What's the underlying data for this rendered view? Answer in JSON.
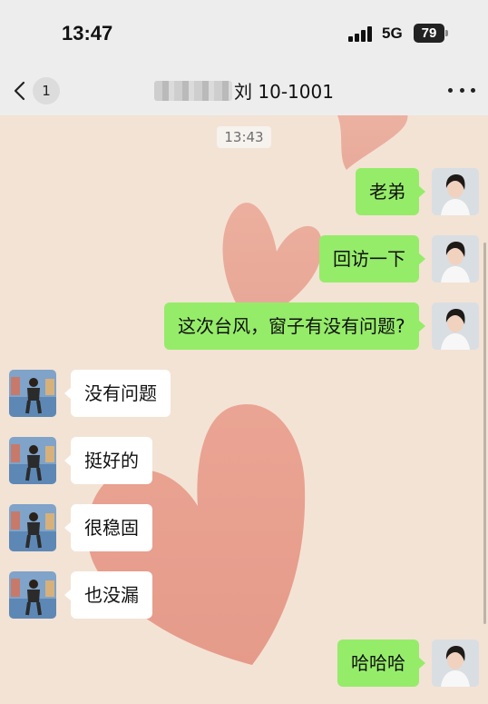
{
  "status_bar": {
    "time": "13:47",
    "network": "5G",
    "battery": "79"
  },
  "nav": {
    "back_count": "1",
    "title": "刘 10-1001"
  },
  "chat": {
    "timestamp": "13:43",
    "messages": [
      {
        "side": "out",
        "text": "老弟"
      },
      {
        "side": "out",
        "text": "回访一下"
      },
      {
        "side": "out",
        "text": "这次台风，窗子有没有问题?"
      },
      {
        "side": "in",
        "text": "没有问题"
      },
      {
        "side": "in",
        "text": "挺好的"
      },
      {
        "side": "in",
        "text": "很稳固"
      },
      {
        "side": "in",
        "text": "也没漏"
      },
      {
        "side": "out",
        "text": "哈哈哈"
      }
    ]
  },
  "colors": {
    "outgoing_bubble": "#95ec69",
    "incoming_bubble": "#ffffff",
    "header_bg": "#ededed",
    "chat_bg": "#f3e3d5"
  }
}
